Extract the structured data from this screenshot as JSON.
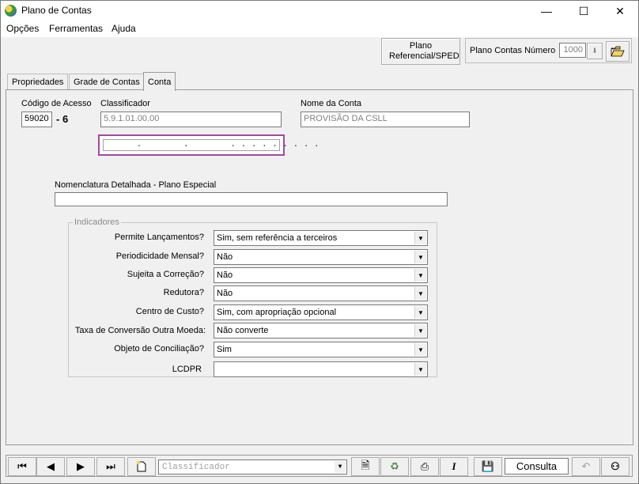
{
  "window": {
    "title": "Plano de Contas",
    "minimize": "—",
    "maximize": "☐",
    "close": "✕"
  },
  "menu": {
    "items": [
      "Opções",
      "Ferramentas",
      "Ajuda"
    ]
  },
  "toolbar": {
    "plano_ref_label": "Plano Referencial/SPED",
    "plano_contas_numero_label": "Plano Contas Número",
    "plano_contas_numero_value": "1000"
  },
  "tabs": [
    "Propriedades",
    "Grade de Contas",
    "Conta"
  ],
  "conta": {
    "codigo_acesso_label": "Código de Acesso",
    "codigo_acesso_value": "59020",
    "codigo_digito": "- 6",
    "classificador_label": "Classificador",
    "classificador_value": "5.9.1.01.00.00",
    "nome_conta_label": "Nome da Conta",
    "nome_conta_value": "PROVISÃO DA CSLL",
    "mask_value": "      .        .        . . . . . . . . .",
    "nomenclatura_label": "Nomenclatura Detalhada - Plano Especial",
    "nomenclatura_value": ""
  },
  "indicadores": {
    "title": "Indicadores",
    "rows": [
      {
        "label": "Permite Lançamentos?",
        "value": "Sim, sem referência a terceiros"
      },
      {
        "label": "Periodicidade Mensal?",
        "value": "Não"
      },
      {
        "label": "Sujeita a Correção?",
        "value": "Não"
      },
      {
        "label": "Redutora?",
        "value": "Não"
      },
      {
        "label": "Centro de Custo?",
        "value": "Sim, com apropriação opcional"
      },
      {
        "label": "Taxa de Conversão Outra Moeda:",
        "value": "Não converte"
      },
      {
        "label": "Objeto de Conciliação?",
        "value": "Sim"
      },
      {
        "label": "LCDPR",
        "value": ""
      }
    ]
  },
  "bottom": {
    "classificador_placeholder": "Classificador",
    "mode": "Consulta"
  },
  "colors": {
    "mask_border": "#a04aa0",
    "background": "#f0f0f0"
  }
}
